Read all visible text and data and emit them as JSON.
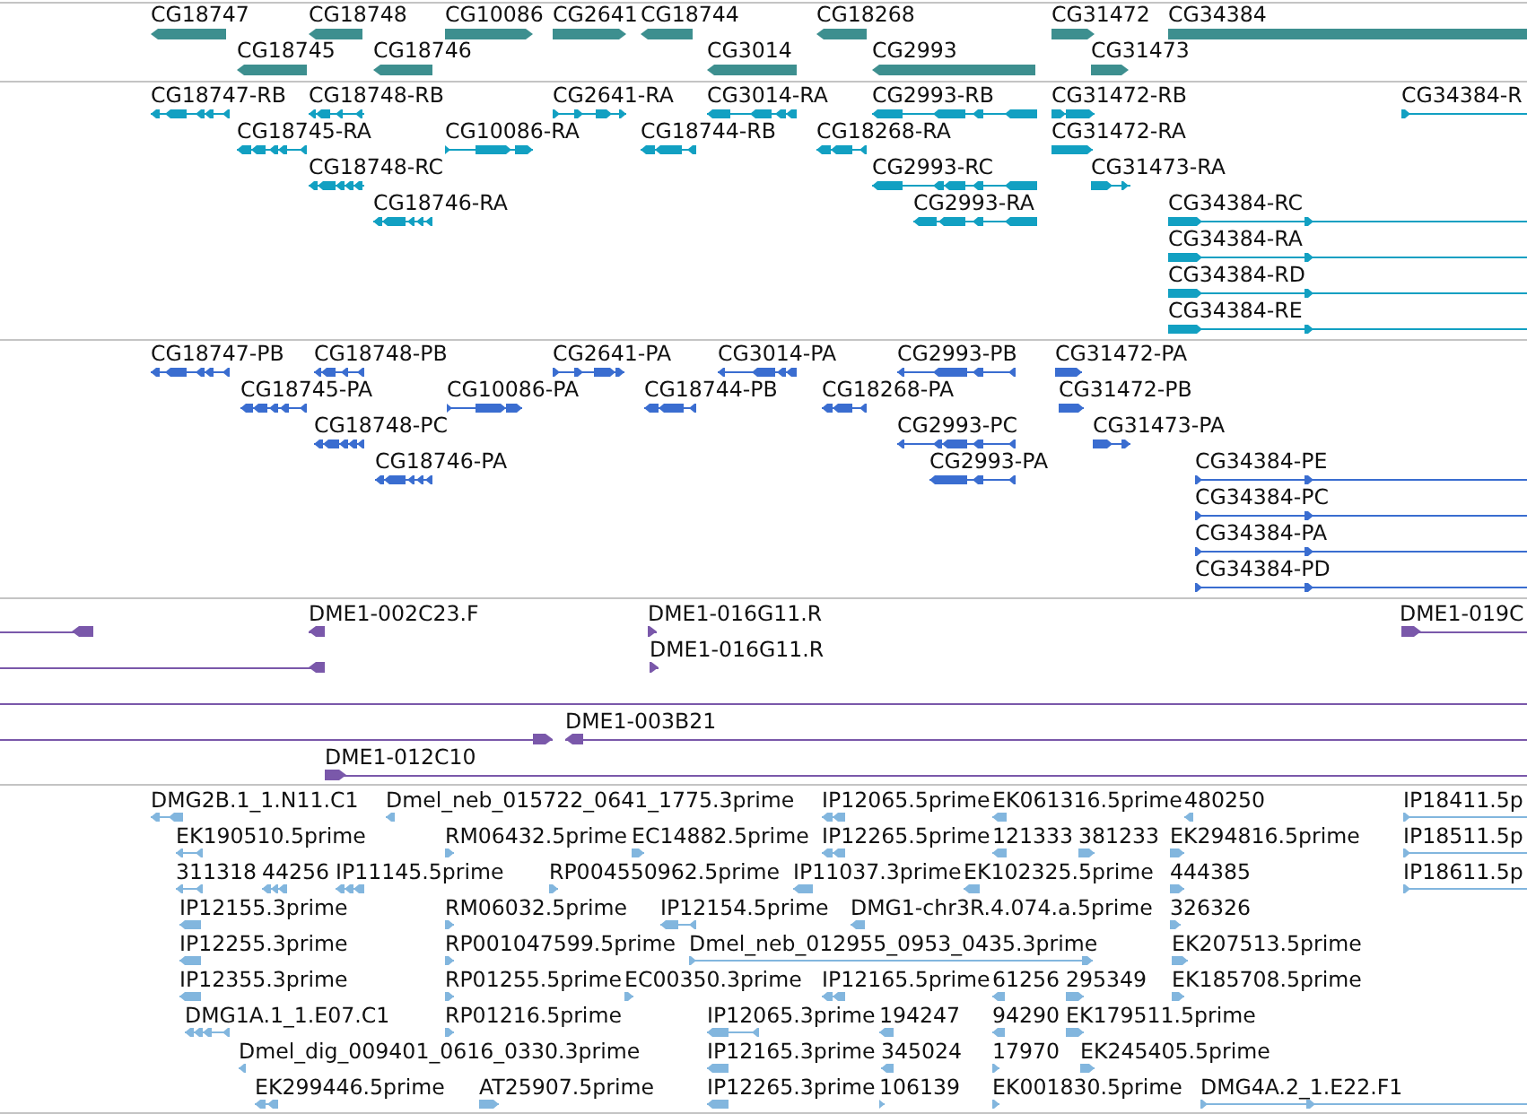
{
  "tracks": [
    {
      "kind": "gene",
      "color": "#3d8f8f",
      "features": [
        {
          "label": "CG18747",
          "reverse": true
        },
        {
          "label": "CG18748",
          "reverse": true
        },
        {
          "label": "CG10086",
          "reverse": false
        },
        {
          "label": "CG2641",
          "reverse": false
        },
        {
          "label": "CG18744",
          "reverse": true
        },
        {
          "label": "CG18268",
          "reverse": true
        },
        {
          "label": "CG31472",
          "reverse": false
        },
        {
          "label": "CG34384",
          "reverse": false
        },
        {
          "label": "CG18745",
          "reverse": true
        },
        {
          "label": "CG18746",
          "reverse": true
        },
        {
          "label": "CG3014",
          "reverse": true
        },
        {
          "label": "CG2993",
          "reverse": true
        },
        {
          "label": "CG31473",
          "reverse": false
        }
      ]
    },
    {
      "kind": "transcript",
      "color": "#12a0c2",
      "features": [
        {
          "label": "CG18747-RB",
          "reverse": true
        },
        {
          "label": "CG18748-RB",
          "reverse": true
        },
        {
          "label": "CG2641-RA",
          "reverse": false
        },
        {
          "label": "CG3014-RA",
          "reverse": true
        },
        {
          "label": "CG2993-RB",
          "reverse": true
        },
        {
          "label": "CG31472-RB",
          "reverse": false
        },
        {
          "label": "CG34384-R",
          "reverse": false
        },
        {
          "label": "CG18745-RA",
          "reverse": true
        },
        {
          "label": "CG10086-RA",
          "reverse": false
        },
        {
          "label": "CG18744-RB",
          "reverse": true
        },
        {
          "label": "CG18268-RA",
          "reverse": true
        },
        {
          "label": "CG31472-RA",
          "reverse": false
        },
        {
          "label": "CG18748-RC",
          "reverse": true
        },
        {
          "label": "CG2993-RC",
          "reverse": true
        },
        {
          "label": "CG31473-RA",
          "reverse": false
        },
        {
          "label": "CG18746-RA",
          "reverse": true
        },
        {
          "label": "CG2993-RA",
          "reverse": true
        },
        {
          "label": "CG34384-RC",
          "reverse": false
        },
        {
          "label": "CG34384-RA",
          "reverse": false
        },
        {
          "label": "CG34384-RD",
          "reverse": false
        },
        {
          "label": "CG34384-RE",
          "reverse": false
        }
      ]
    },
    {
      "kind": "protein",
      "color": "#3a6dd0",
      "features": [
        {
          "label": "CG18747-PB",
          "reverse": true
        },
        {
          "label": "CG18748-PB",
          "reverse": true
        },
        {
          "label": "CG2641-PA",
          "reverse": false
        },
        {
          "label": "CG3014-PA",
          "reverse": true
        },
        {
          "label": "CG2993-PB",
          "reverse": true
        },
        {
          "label": "CG31472-PA",
          "reverse": false
        },
        {
          "label": "CG18745-PA",
          "reverse": true
        },
        {
          "label": "CG10086-PA",
          "reverse": false
        },
        {
          "label": "CG18744-PB",
          "reverse": true
        },
        {
          "label": "CG18268-PA",
          "reverse": true
        },
        {
          "label": "CG31472-PB",
          "reverse": false
        },
        {
          "label": "CG18748-PC",
          "reverse": true
        },
        {
          "label": "CG2993-PC",
          "reverse": true
        },
        {
          "label": "CG31473-PA",
          "reverse": false
        },
        {
          "label": "CG18746-PA",
          "reverse": true
        },
        {
          "label": "CG2993-PA",
          "reverse": true
        },
        {
          "label": "CG34384-PE",
          "reverse": false
        },
        {
          "label": "CG34384-PC",
          "reverse": false
        },
        {
          "label": "CG34384-PA",
          "reverse": false
        },
        {
          "label": "CG34384-PD",
          "reverse": false
        }
      ]
    },
    {
      "kind": "clone",
      "color": "#7a58aa",
      "features": [
        {
          "kind": "arrow",
          "reverse": true
        },
        {
          "label": "DME1-002C23.F",
          "kind": "arrow",
          "reverse": true
        },
        {
          "label": "DME1-016G11.R",
          "kind": "arrow",
          "reverse": false
        },
        {
          "label": "DME1-019C",
          "kind": "arrow",
          "reverse": false
        },
        {
          "kind": "arrow",
          "reverse": true
        },
        {
          "label": "DME1-016G11.R",
          "kind": "arrow",
          "reverse": false
        },
        {
          "kind": "line"
        },
        {
          "kind": "arrow",
          "reverse": false
        },
        {
          "label": "DME1-003B21",
          "kind": "arrow",
          "reverse": true
        },
        {
          "label": "DME1-012C10",
          "kind": "arrow",
          "reverse": false
        }
      ]
    },
    {
      "kind": "est",
      "color": "#82b6de",
      "features": [
        {
          "label": "DMG2B.1_1.N11.C1",
          "reverse": true
        },
        {
          "label": "Dmel_neb_015722_0641_1775.3prime",
          "reverse": true
        },
        {
          "label": "IP12065.5prime",
          "reverse": true
        },
        {
          "label": "EK061316.5prime",
          "reverse": true
        },
        {
          "label": "480250",
          "reverse": true
        },
        {
          "label": "IP18411.5p",
          "reverse": false
        },
        {
          "label": "EK190510.5prime",
          "reverse": true
        },
        {
          "label": "RM06432.5prime",
          "reverse": false
        },
        {
          "label": "EC14882.5prime",
          "reverse": false
        },
        {
          "label": "IP12265.5prime",
          "reverse": true
        },
        {
          "label": "121333",
          "reverse": true
        },
        {
          "label": "381233",
          "reverse": false
        },
        {
          "label": "EK294816.5prime",
          "reverse": false
        },
        {
          "label": "IP18511.5p",
          "reverse": false
        },
        {
          "label": "311318",
          "reverse": true
        },
        {
          "label": "44256",
          "reverse": true
        },
        {
          "label": "IP11145.5prime",
          "reverse": true
        },
        {
          "label": "RP004550962.5prime",
          "reverse": false
        },
        {
          "label": "IP11037.3prime",
          "reverse": true
        },
        {
          "label": "EK102325.5prime",
          "reverse": true
        },
        {
          "label": "444385",
          "reverse": false
        },
        {
          "label": "IP18611.5p",
          "reverse": false
        },
        {
          "label": "IP12155.3prime",
          "reverse": true
        },
        {
          "label": "RM06032.5prime",
          "reverse": false
        },
        {
          "label": "IP12154.5prime",
          "reverse": true
        },
        {
          "label": "DMG1-chr3R.4.074.a.5prime",
          "reverse": true
        },
        {
          "label": "326326",
          "reverse": false
        },
        {
          "label": "IP12255.3prime",
          "reverse": true
        },
        {
          "label": "RP001047599.5prime",
          "reverse": false
        },
        {
          "label": "Dmel_neb_012955_0953_0435.3prime",
          "reverse": false
        },
        {
          "label": "EK207513.5prime",
          "reverse": false
        },
        {
          "label": "IP12355.3prime",
          "reverse": true
        },
        {
          "label": "RP01255.5prime",
          "reverse": false
        },
        {
          "label": "EC00350.3prime",
          "reverse": false
        },
        {
          "label": "IP12165.5prime",
          "reverse": true
        },
        {
          "label": "61256",
          "reverse": true
        },
        {
          "label": "295349",
          "reverse": false
        },
        {
          "label": "EK185708.5prime",
          "reverse": false
        },
        {
          "label": "DMG1A.1_1.E07.C1",
          "reverse": true
        },
        {
          "label": "RP01216.5prime",
          "reverse": false
        },
        {
          "label": "IP12065.3prime",
          "reverse": true
        },
        {
          "label": "194247",
          "reverse": true
        },
        {
          "label": "94290",
          "reverse": true
        },
        {
          "label": "EK179511.5prime",
          "reverse": false
        },
        {
          "label": "Dmel_dig_009401_0616_0330.3prime",
          "reverse": true
        },
        {
          "label": "IP12165.3prime",
          "reverse": true
        },
        {
          "label": "345024",
          "reverse": true
        },
        {
          "label": "17970",
          "reverse": false
        },
        {
          "label": "EK245405.5prime",
          "reverse": false
        },
        {
          "label": "EK299446.5prime",
          "reverse": true
        },
        {
          "label": "AT25907.5prime",
          "reverse": false
        },
        {
          "label": "IP12265.3prime",
          "reverse": true
        },
        {
          "label": "106139",
          "reverse": false
        },
        {
          "label": "EK001830.5prime",
          "reverse": false
        },
        {
          "label": "DMG4A.2_1.E22.F1",
          "reverse": false
        }
      ]
    }
  ]
}
